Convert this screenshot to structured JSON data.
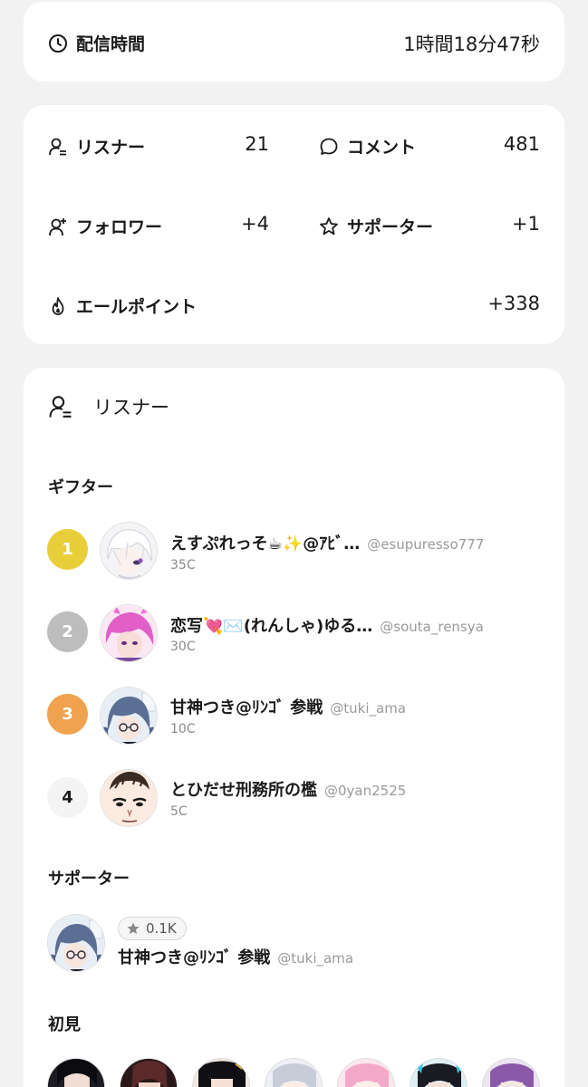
{
  "broadcast": {
    "label": "配信時間",
    "value": "1時間18分47秒"
  },
  "stats": {
    "listener_label": "リスナー",
    "listener_value": "21",
    "comment_label": "コメント",
    "comment_value": "481",
    "follower_label": "フォロワー",
    "follower_value": "+4",
    "supporter_label": "サポーター",
    "supporter_value": "+1",
    "yell_label": "エールポイント",
    "yell_value": "+338"
  },
  "listeners": {
    "title": "リスナー",
    "gifters_heading": "ギフター",
    "gifters": [
      {
        "rank": "1",
        "name": "えすぷれっそ☕✨@ｱﾋﾞ…",
        "handle": "@esupuresso777",
        "coins": "35C",
        "rank_color": "#e8cf3a"
      },
      {
        "rank": "2",
        "name": "恋写💘✉️(れんしゃ)ゆる…",
        "handle": "@souta_rensya",
        "coins": "30C",
        "rank_color": "#bdbdbd"
      },
      {
        "rank": "3",
        "name": "甘神つき@ﾘﾝｺﾞ 参戦",
        "handle": "@tuki_ama",
        "coins": "10C",
        "rank_color": "#f0a24e"
      },
      {
        "rank": "4",
        "name": "とひだせ刑務所の檻",
        "handle": "@0yan2525",
        "coins": "5C",
        "rank_color": "#f4f4f4"
      }
    ],
    "supporters_heading": "サポーター",
    "supporter": {
      "badge_value": "0.1K",
      "name": "甘神つき@ﾘﾝｺﾞ 参戦",
      "handle": "@tuki_ama"
    },
    "first_time_heading": "初見"
  },
  "icons": {
    "broadcast": "clock-icon",
    "listener": "person-list-icon",
    "comment": "speech-bubble-icon",
    "follower": "person-add-icon",
    "supporter": "star-icon",
    "yell": "flame-icon"
  },
  "colors": {
    "background": "#f2f2f2",
    "card": "#ffffff",
    "rank_gold": "#e8cf3a",
    "rank_silver": "#bdbdbd",
    "rank_bronze": "#f0a24e",
    "muted_text": "#9a9a9a"
  }
}
